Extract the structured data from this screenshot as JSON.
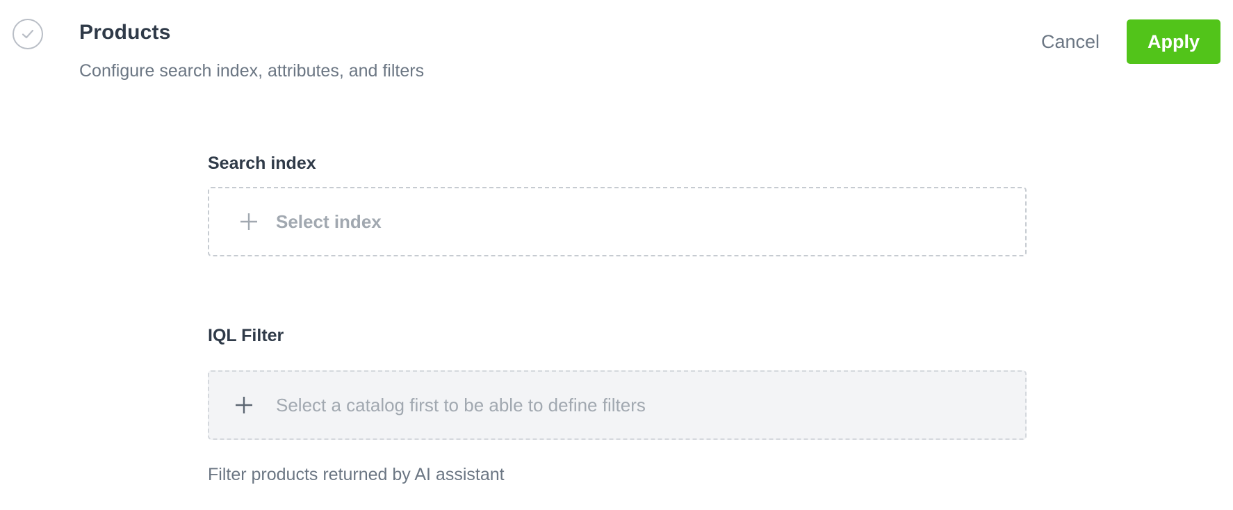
{
  "header": {
    "title": "Products",
    "subtitle": "Configure search index, attributes, and filters",
    "step_icon": "check-circle-icon"
  },
  "actions": {
    "cancel_label": "Cancel",
    "apply_label": "Apply",
    "apply_color": "#52c41a"
  },
  "search_index": {
    "label": "Search index",
    "placeholder": "Select index",
    "icon": "plus-icon"
  },
  "iql_filter": {
    "label": "IQL Filter",
    "placeholder": "Select a catalog first to be able to define filters",
    "icon": "plus-icon",
    "help_text": "Filter products returned by AI assistant"
  }
}
